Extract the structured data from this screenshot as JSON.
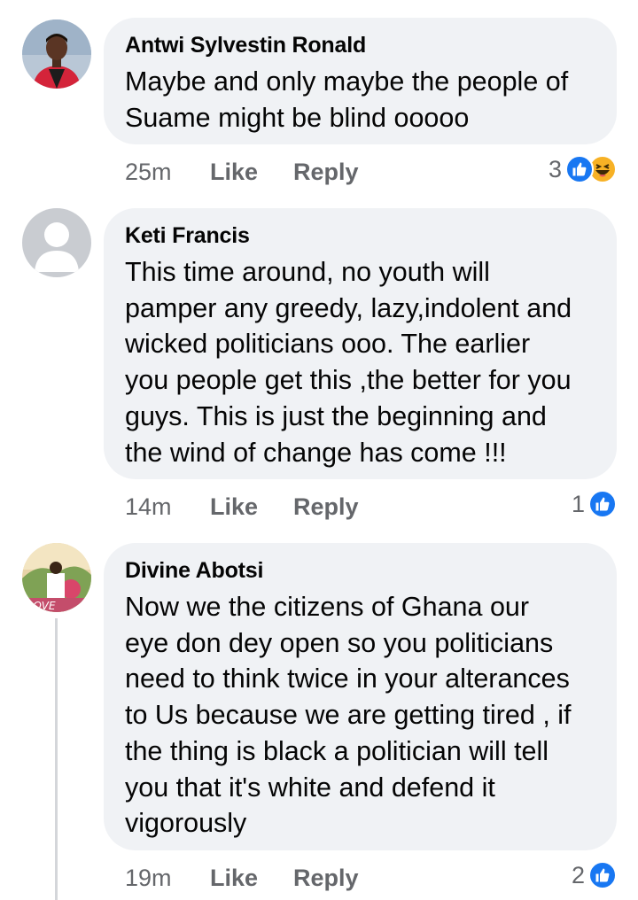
{
  "comments": [
    {
      "author": "Antwi Sylvestin Ronald",
      "text": "Maybe and only maybe the people of\nSuame might be blind ooooo",
      "time": "25m",
      "like_label": "Like",
      "reply_label": "Reply",
      "reaction_count": "3",
      "reactions": [
        "like-icon",
        "haha-icon"
      ]
    },
    {
      "author": "Keti Francis",
      "text": "This time around, no youth will\npamper any greedy, lazy,indolent  and\nwicked politicians ooo. The earlier\nyou people get this ,the better for you\nguys. This is just the beginning and\nthe wind of change has come !!!",
      "time": "14m",
      "like_label": "Like",
      "reply_label": "Reply",
      "reaction_count": "1",
      "reactions": [
        "like-icon"
      ]
    },
    {
      "author": "Divine Abotsi",
      "text": "Now we the citizens of Ghana our\neye don dey open so you politicians\nneed to think twice in your alterances\nto Us because we are getting tired , if\nthe thing is black a politician will tell\nyou that it's white and defend it\nvigorously",
      "time": "19m",
      "like_label": "Like",
      "reply_label": "Reply",
      "reaction_count": "2",
      "reactions": [
        "like-icon"
      ]
    }
  ],
  "colors": {
    "bubble": "#f0f2f5",
    "meta_text": "#65676b",
    "like_blue": "#1877f2",
    "haha_yellow": "#f7b125"
  }
}
